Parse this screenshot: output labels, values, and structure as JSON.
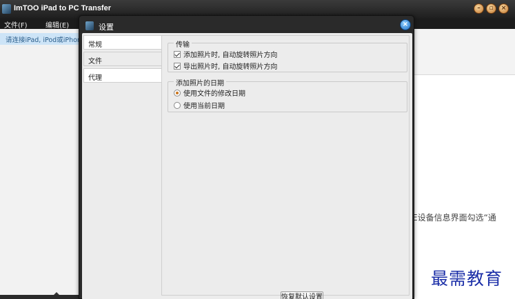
{
  "app": {
    "title": "ImTOO iPad to PC Transfer",
    "menu": [
      {
        "label": "文件(F)"
      },
      {
        "label": "编辑(E)"
      }
    ],
    "device_hint": "请连接iPad, iPod或iPhone",
    "right_text": "E设备信息界面勾选“通",
    "watermark": "最需教育"
  },
  "dialog": {
    "title": "设置",
    "tabs": [
      {
        "label": "常规",
        "active": false
      },
      {
        "label": "文件",
        "active": true
      },
      {
        "label": "代理",
        "active": false
      }
    ],
    "transfer_group": {
      "legend": "传输",
      "options": [
        {
          "label": "添加照片时, 自动旋转照片方向",
          "checked": true
        },
        {
          "label": "导出照片时, 自动旋转照片方向",
          "checked": true
        }
      ]
    },
    "date_group": {
      "legend": "添加照片的日期",
      "options": [
        {
          "label": "使用文件的修改日期",
          "selected": true
        },
        {
          "label": "使用当前日期",
          "selected": false
        }
      ]
    },
    "restore_button": "恢复默认设置"
  },
  "colors": {
    "titlebar": "#1e1e1e",
    "hint_bg": "#cde4f7",
    "watermark": "#1c2fa8",
    "radio_accent": "#c9741c"
  },
  "icons": [
    "app-logo-icon",
    "minimize-icon",
    "maximize-icon",
    "close-icon"
  ]
}
